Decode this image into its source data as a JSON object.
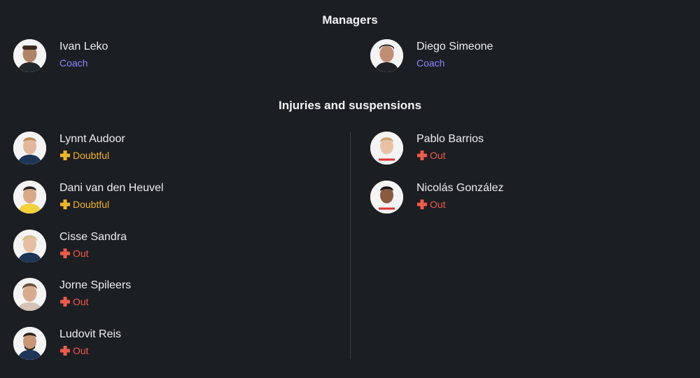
{
  "managers": {
    "title": "Managers",
    "items": [
      {
        "name": "Ivan Leko",
        "role": "Coach",
        "role_color": "#8f86ff"
      },
      {
        "name": "Diego Simeone",
        "role": "Coach",
        "role_color": "#8f86ff"
      }
    ]
  },
  "injuries": {
    "title": "Injuries and suspensions",
    "left": [
      {
        "name": "Lynnt Audoor",
        "status": "Doubtful",
        "icon": "plus-cross-icon"
      },
      {
        "name": "Dani van den Heuvel",
        "status": "Doubtful",
        "icon": "plus-cross-icon"
      },
      {
        "name": "Cisse Sandra",
        "status": "Out",
        "icon": "plus-cross-icon"
      },
      {
        "name": "Jorne Spileers",
        "status": "Out",
        "icon": "plus-cross-icon"
      },
      {
        "name": "Ludovit Reis",
        "status": "Out",
        "icon": "plus-cross-icon"
      }
    ],
    "right": [
      {
        "name": "Pablo Barrios",
        "status": "Out",
        "icon": "plus-cross-icon"
      },
      {
        "name": "Nicolás González",
        "status": "Out",
        "icon": "plus-cross-icon"
      }
    ]
  },
  "colors": {
    "background": "#1b1e22",
    "doubtful": "#f0b429",
    "out": "#ef5a49",
    "coach": "#8f86ff",
    "divider": "#3a3e44"
  }
}
